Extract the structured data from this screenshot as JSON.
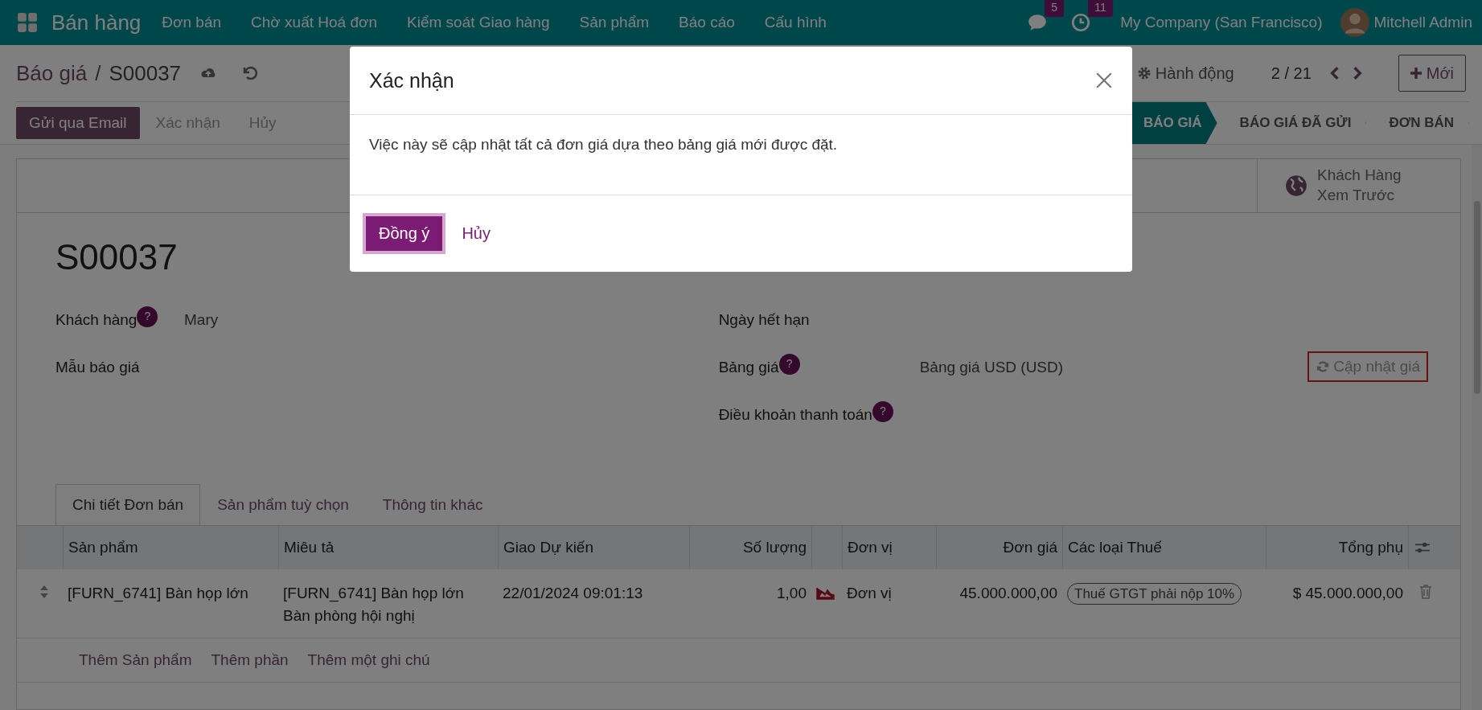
{
  "navbar": {
    "app_name": "Bán hàng",
    "menu": [
      "Đơn bán",
      "Chờ xuất Hoá đơn",
      "Kiểm soát Giao hàng",
      "Sản phẩm",
      "Báo cáo",
      "Cấu hình"
    ],
    "messages_count": "5",
    "activities_count": "11",
    "company": "My Company (San Francisco)",
    "user": "Mitchell Admin"
  },
  "breadcrumb": {
    "parent": "Báo giá",
    "separator": "/",
    "current": "S00037"
  },
  "actions_label": "Hành động",
  "pager": "2 / 21",
  "new_button": "Mới",
  "action_buttons": [
    {
      "label": "Gửi qua Email",
      "kind": "primary"
    },
    {
      "label": "Xác nhận",
      "kind": "secondary"
    },
    {
      "label": "Hủy",
      "kind": "secondary"
    }
  ],
  "statusbar": [
    {
      "label": "BÁO GIÁ",
      "selected": true
    },
    {
      "label": "BÁO GIÁ ĐÃ GỬI",
      "selected": false
    },
    {
      "label": "ĐƠN BÁN",
      "selected": false
    }
  ],
  "stat_button": "Khách Hàng Xem Trước",
  "record_name": "S00037",
  "fields_left": [
    {
      "label": "Khách hàng",
      "help": "?",
      "value": "Mary"
    },
    {
      "label": "Mẫu báo giá"
    }
  ],
  "fields_right": [
    {
      "label": "Ngày hết hạn"
    },
    {
      "label": "Bảng giá",
      "help": "?",
      "value": "Bảng giá USD (USD)",
      "button": "Cập nhật giá",
      "highlighted": true
    },
    {
      "label": "Điều khoản thanh toán",
      "help": "?"
    }
  ],
  "tabs": [
    {
      "label": "Chi tiết Đơn bán",
      "selected": true
    },
    {
      "label": "Sản phẩm tuỳ chọn",
      "selected": false
    },
    {
      "label": "Thông tin khác",
      "selected": false
    }
  ],
  "table": {
    "columns": [
      "Sản phẩm",
      "Miêu tả",
      "Giao Dự kiến",
      "Số lượng",
      "Đơn vị",
      "Đơn giá",
      "Các loại Thuế",
      "Tổng phụ"
    ],
    "rows": [
      {
        "product": "[FURN_6741] Bàn họp lớn",
        "description": [
          "[FURN_6741] Bàn họp lớn",
          "Bàn phòng hội nghị"
        ],
        "delivery": "22/01/2024 09:01:13",
        "quantity": "1,00",
        "unit": "Đơn vị",
        "unit_price": "45.000.000,00",
        "taxes": [
          "Thuế GTGT phải nộp 10%"
        ],
        "subtotal": "$ 45.000.000,00"
      }
    ],
    "add_links": [
      "Thêm Sản phẩm",
      "Thêm phần",
      "Thêm một ghi chú"
    ]
  },
  "dialog": {
    "title": "Xác nhận",
    "message": "Việc này sẽ cập nhật tất cả đơn giá dựa theo bảng giá mới được đặt.",
    "buttons": [
      {
        "label": "Đồng ý",
        "kind": "primary"
      },
      {
        "label": "Hủy",
        "kind": "link"
      }
    ]
  }
}
